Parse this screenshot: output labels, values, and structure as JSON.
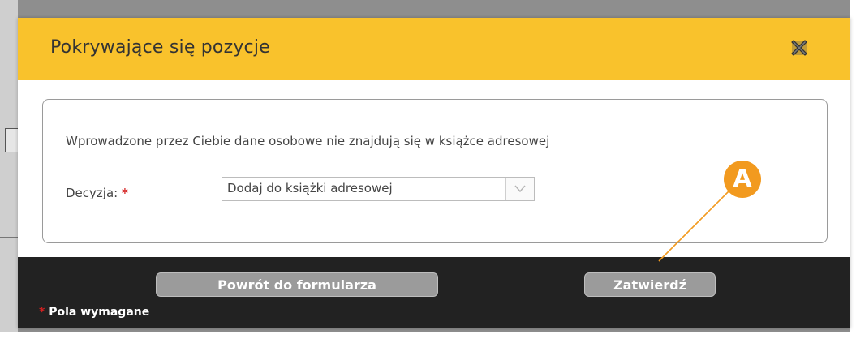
{
  "dialog": {
    "title": "Pokrywające się pozycje",
    "close_icon": "close-icon"
  },
  "content": {
    "message": "Wprowadzone przez Ciebie dane osobowe nie znajdują się w książce adresowej",
    "decision_label": "Decyzja:",
    "required_marker": "*",
    "decision_select": {
      "selected": "Dodaj do książki adresowej",
      "arrow_icon": "chevron-down-icon"
    }
  },
  "footer": {
    "back_button": "Powrót do formularza",
    "confirm_button": "Zatwierdź",
    "required_marker": "*",
    "required_note": "Pola wymagane"
  },
  "annotation": {
    "marker_label": "A",
    "color": "#f29a1f"
  },
  "colors": {
    "header": "#f9c22c",
    "footer": "#222222",
    "button": "#9b9b9b",
    "required": "#d42020"
  }
}
